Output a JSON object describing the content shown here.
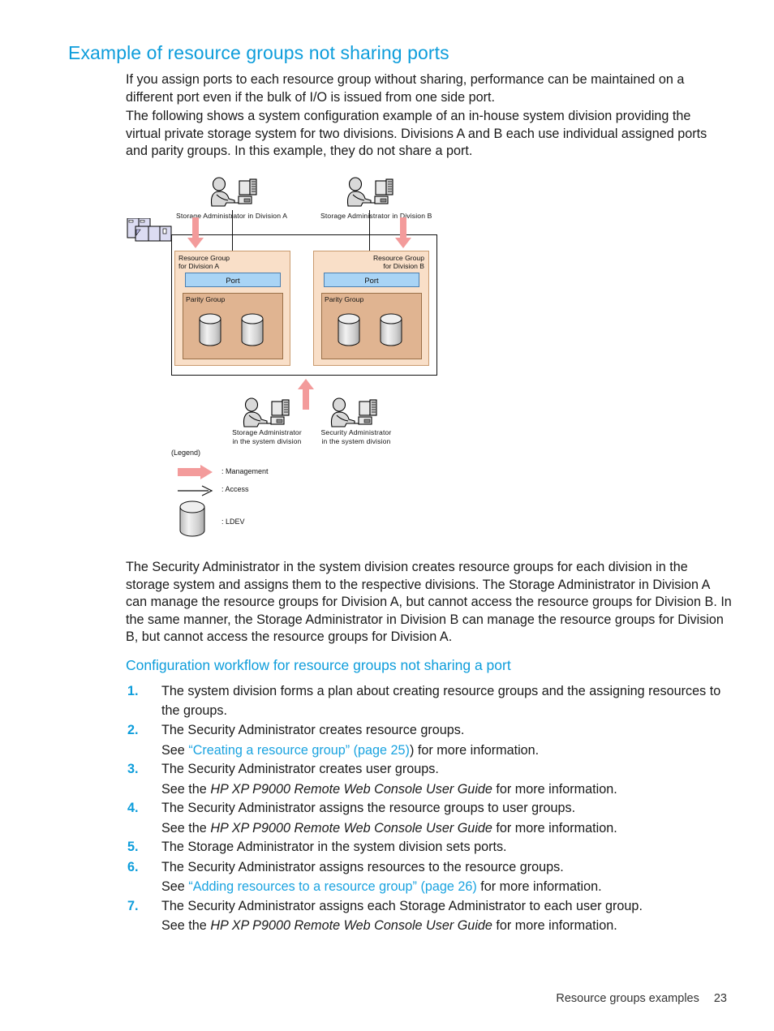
{
  "document": {
    "title": "Example of resource groups not sharing ports",
    "paragraphs": {
      "p1": "If you assign ports to each resource group without sharing, performance can be maintained on a different port even if the bulk of I/O is issued from one side port.",
      "p2": "The following shows a system configuration example of an in-house system division providing the virtual private storage system for two divisions. Divisions A and B each use individual assigned ports and parity groups. In this example, they do not share a port.",
      "p3": "The Security Administrator in the system division creates resource groups for each division in the storage system and assigns them to the respective divisions. The Storage Administrator in Division A can manage the resource groups for Division A, but cannot access the resource groups for Division B. In the same manner, the Storage Administrator in Division B can manage the resource groups for Division B, but cannot access the resource groups for Division A."
    },
    "subheading": "Configuration workflow for resource groups not sharing a port",
    "steps": [
      {
        "num": "1.",
        "text": "The system division forms a plan about creating resource groups and the assigning resources to the groups."
      },
      {
        "num": "2.",
        "text": "The Security Administrator creates resource groups.",
        "sub_prefix": "See ",
        "sub_link": "“Creating a resource group” (page 25)",
        "sub_suffix": ") for more information."
      },
      {
        "num": "3.",
        "text": "The Security Administrator creates user groups.",
        "sub_prefix": "See the ",
        "sub_italic": "HP XP P9000 Remote Web Console User Guide",
        "sub_suffix": " for more information."
      },
      {
        "num": "4.",
        "text": "The Security Administrator assigns the resource groups to user groups.",
        "sub_prefix": "See the ",
        "sub_italic": "HP XP P9000 Remote Web Console User Guide",
        "sub_suffix": " for more information."
      },
      {
        "num": "5.",
        "text": "The Storage Administrator in the system division sets ports."
      },
      {
        "num": "6.",
        "text": "The Security Administrator assigns resources to the resource groups.",
        "sub_prefix": "See ",
        "sub_link": "“Adding resources to a resource group” (page 26)",
        "sub_suffix": " for more information."
      },
      {
        "num": "7.",
        "text": "The Security Administrator assigns each Storage Administrator to each user group.",
        "sub_prefix": "See the ",
        "sub_italic": "HP XP P9000 Remote Web Console User Guide",
        "sub_suffix": " for more information."
      }
    ],
    "footer": {
      "chapter": "Resource groups examples",
      "page": "23"
    }
  },
  "diagram": {
    "actors": {
      "top_left": "Storage Administrator in Division A",
      "top_right": "Storage Administrator in Division B",
      "bottom_left_line1": "Storage Administrator",
      "bottom_left_line2": "in the system division",
      "bottom_right_line1": "Security Administrator",
      "bottom_right_line2": "in the system division"
    },
    "resource_group_a": {
      "title_line1": "Resource Group",
      "title_line2": "for Division A",
      "port": "Port",
      "parity_group": "Parity Group"
    },
    "resource_group_b": {
      "title_line1": "Resource Group",
      "title_line2": "for Division B",
      "port": "Port",
      "parity_group": "Parity Group"
    },
    "legend": {
      "title": "(Legend)",
      "management": ": Management",
      "access": ": Access",
      "ldev": ": LDEV"
    },
    "colors": {
      "arrow": "#f39b9b",
      "resource_group_fill": "#f9dfc8",
      "parity_group_fill": "#e0b491",
      "port_fill": "#a9d4f5",
      "host_fill": "#d8d8f0",
      "heading_blue": "#0d9ddb"
    }
  }
}
